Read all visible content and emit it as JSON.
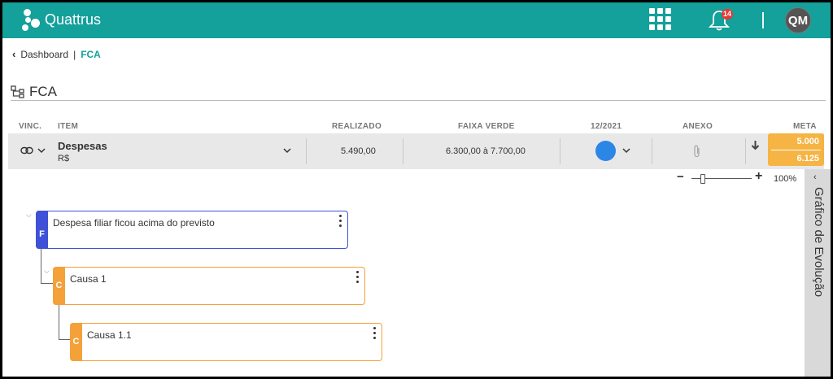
{
  "app": {
    "brand": "Quattrus"
  },
  "header": {
    "notifications_count": "14",
    "user_initials": "QM"
  },
  "breadcrumb": {
    "home": "Dashboard",
    "current": "FCA"
  },
  "page": {
    "title": "FCA"
  },
  "table": {
    "columns": {
      "vinc": "VINC.",
      "item": "ITEM",
      "realizado": "REALIZADO",
      "faixa": "FAIXA VERDE",
      "period": "12/2021",
      "anexo": "ANEXO",
      "meta": "META"
    },
    "row": {
      "item_name": "Despesas",
      "item_unit": "R$",
      "realizado": "5.490,00",
      "faixa": "6.300,00 à 7.700,00",
      "status_color": "#2b86e6",
      "meta_top": "5.000",
      "meta_bottom": "6.125"
    }
  },
  "zoom": {
    "value": "100%"
  },
  "side_panel": {
    "label": "Gráfico de Evolução"
  },
  "tree": [
    {
      "tag": "F",
      "text": "Despesa filiar ficou acima do previsto",
      "color": "#3f51d6"
    },
    {
      "tag": "C",
      "text": "Causa 1",
      "color": "#f5a13a"
    },
    {
      "tag": "C",
      "text": "Causa 1.1",
      "color": "#f5a13a"
    }
  ],
  "icons": {
    "logo": "quattrus-logo-icon",
    "apps": "apps-grid-icon",
    "bell": "bell-icon",
    "back": "chevron-left-icon",
    "title": "hierarchy-icon",
    "link": "link-icon",
    "attach": "paperclip-icon",
    "trend": "arrow-down-icon"
  }
}
